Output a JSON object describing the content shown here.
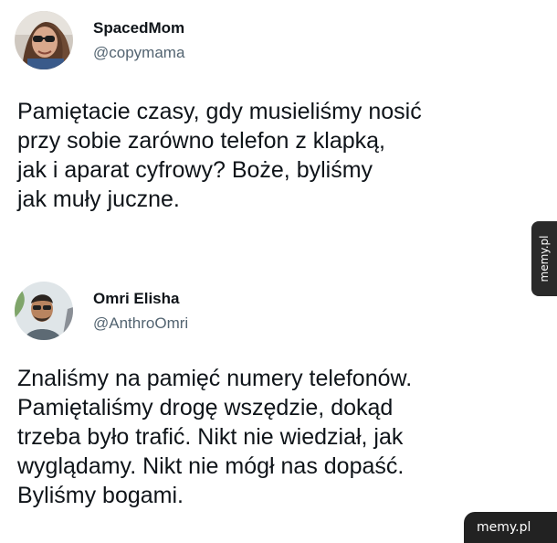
{
  "tweets": [
    {
      "author": {
        "display_name": "SpacedMom",
        "handle": "@copymama"
      },
      "body_lines": [
        "Pamiętacie czasy, gdy musieliśmy nosić",
        "przy sobie zarówno telefon z klapką,",
        "jak i aparat cyfrowy? Boże, byliśmy",
        "jak muły juczne."
      ]
    },
    {
      "author": {
        "display_name": "Omri Elisha",
        "handle": "@AnthroOmri"
      },
      "body_lines": [
        "Znaliśmy na pamięć numery telefonów.",
        "Pamiętaliśmy drogę wszędzie, dokąd",
        "trzeba było trafić. Nikt nie wiedział, jak",
        "wyglądamy. Nikt nie mógł nas dopaść.",
        "Byliśmy bogami."
      ]
    }
  ],
  "watermarks": {
    "side": "memy.pl",
    "corner": "memy.pl"
  },
  "colors": {
    "text": "#0f1419",
    "handle": "#536471",
    "background": "#ffffff",
    "watermark_bg": "#222222"
  }
}
